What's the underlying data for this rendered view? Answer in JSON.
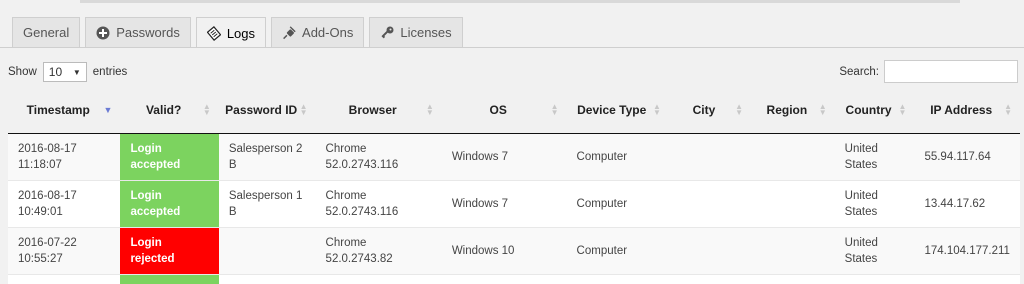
{
  "tabs": [
    {
      "label": "General",
      "icon": null,
      "active": false
    },
    {
      "label": "Passwords",
      "icon": "plus-circle-icon",
      "active": false
    },
    {
      "label": "Logs",
      "icon": "clipboard-icon",
      "active": true
    },
    {
      "label": "Add-Ons",
      "icon": "plug-icon",
      "active": false
    },
    {
      "label": "Licenses",
      "icon": "key-icon",
      "active": false
    }
  ],
  "length": {
    "show_label": "Show",
    "value": "10",
    "entries_label": "entries"
  },
  "search": {
    "label": "Search:",
    "value": ""
  },
  "table": {
    "headers": {
      "timestamp": "Timestamp",
      "valid": "Valid?",
      "password_id": "Password ID",
      "browser": "Browser",
      "os": "OS",
      "device_type": "Device Type",
      "city": "City",
      "region": "Region",
      "country": "Country",
      "ip": "IP Address"
    },
    "sorted_column": "timestamp",
    "rows": [
      {
        "timestamp": "2016-08-17 11:18:07",
        "valid": "Login accepted",
        "status": "accepted",
        "password_id": "Salesperson 2 B",
        "browser": "Chrome 52.0.2743.116",
        "os": "Windows 7",
        "device_type": "Computer",
        "city": "",
        "region": "",
        "country": "United States",
        "ip": "55.94.117.64"
      },
      {
        "timestamp": "2016-08-17 10:49:01",
        "valid": "Login accepted",
        "status": "accepted",
        "password_id": "Salesperson 1 B",
        "browser": "Chrome 52.0.2743.116",
        "os": "Windows 7",
        "device_type": "Computer",
        "city": "",
        "region": "",
        "country": "United States",
        "ip": "13.44.17.62"
      },
      {
        "timestamp": "2016-07-22 10:55:27",
        "valid": "Login rejected",
        "status": "rejected",
        "password_id": "",
        "browser": "Chrome 52.0.2743.82",
        "os": "Windows 10",
        "device_type": "Computer",
        "city": "",
        "region": "",
        "country": "United States",
        "ip": "174.104.177.211"
      }
    ],
    "partial_row_status": "accepted"
  },
  "colors": {
    "accepted": "#7cd35f",
    "rejected": "#ff0000",
    "sort_active": "#6b7bd4"
  }
}
